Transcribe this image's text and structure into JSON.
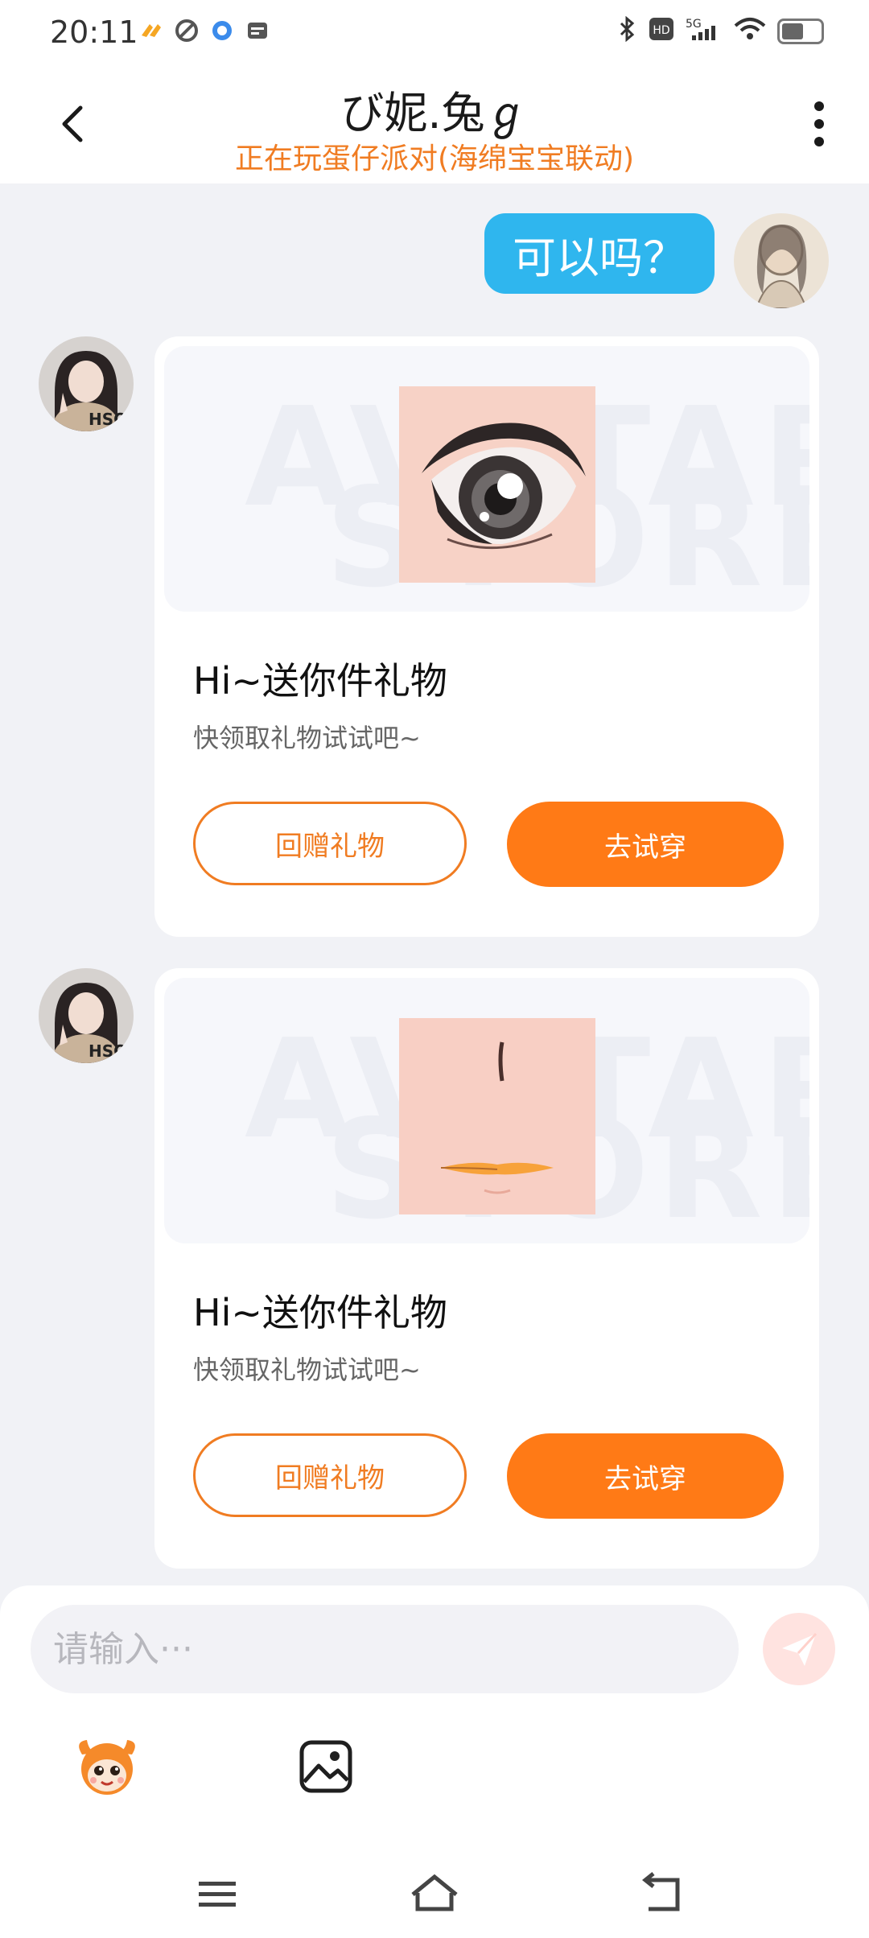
{
  "status_bar": {
    "time": "20:11",
    "app_icons": [
      "taobao-icon",
      "app-swirl-icon",
      "browser-icon",
      "wallet-icon"
    ],
    "right_icons": [
      "bluetooth-icon",
      "hd-icon",
      "5g-signal-icon",
      "wifi-icon",
      "battery-icon"
    ]
  },
  "header": {
    "title": "び妮.兔ℊ",
    "subtitle": "正在玩蛋仔派对(海绵宝宝联动)"
  },
  "messages": {
    "outgoing_text": "可以吗？",
    "gift_cards": [
      {
        "item": "eye-icon",
        "watermark_line1": "AVATAR",
        "watermark_line2": "STORE",
        "title": "Hi~送你件礼物",
        "description": "快领取礼物试试吧~",
        "return_gift_label": "回赠礼物",
        "try_on_label": "去试穿"
      },
      {
        "item": "mouth-face-icon",
        "watermark_line1": "AVATAR",
        "watermark_line2": "STORE",
        "title": "Hi~送你件礼物",
        "description": "快领取礼物试试吧~",
        "return_gift_label": "回赠礼物",
        "try_on_label": "去试穿"
      }
    ]
  },
  "input": {
    "placeholder": "请输入···",
    "value": ""
  },
  "colors": {
    "accent_orange": "#ff7a16",
    "subtitle_orange": "#f07c22",
    "bubble_blue": "#2fb6ee",
    "background": "#f1f2f6"
  }
}
